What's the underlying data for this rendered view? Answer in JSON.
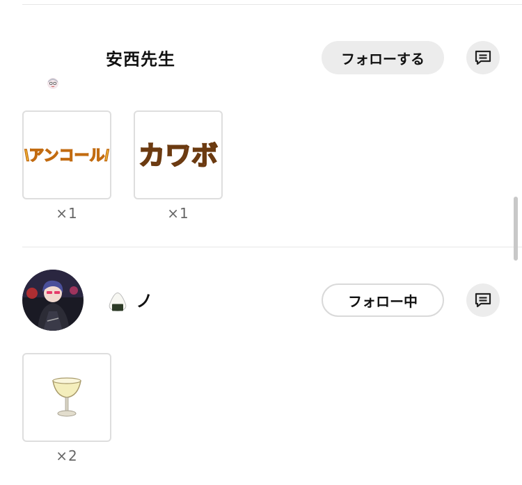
{
  "users": [
    {
      "name": "安西先生",
      "follow_label": "フォローする",
      "gifts": [
        {
          "label": "\\アンコール/",
          "count": "×1"
        },
        {
          "label": "カワボ",
          "count": "×1"
        }
      ]
    },
    {
      "name": "ノ",
      "name_icon": "onigiri-icon",
      "follow_label": "フォロー中",
      "gifts": [
        {
          "label": "cocktail-glass-icon",
          "count": "×2"
        }
      ]
    }
  ],
  "colors": {
    "button_bg": "#ececec",
    "border": "#dedede",
    "encore_orange": "#f0a020",
    "kawabo_pink": "#f07ab0",
    "kawabo_yellow": "#f7c21a"
  }
}
